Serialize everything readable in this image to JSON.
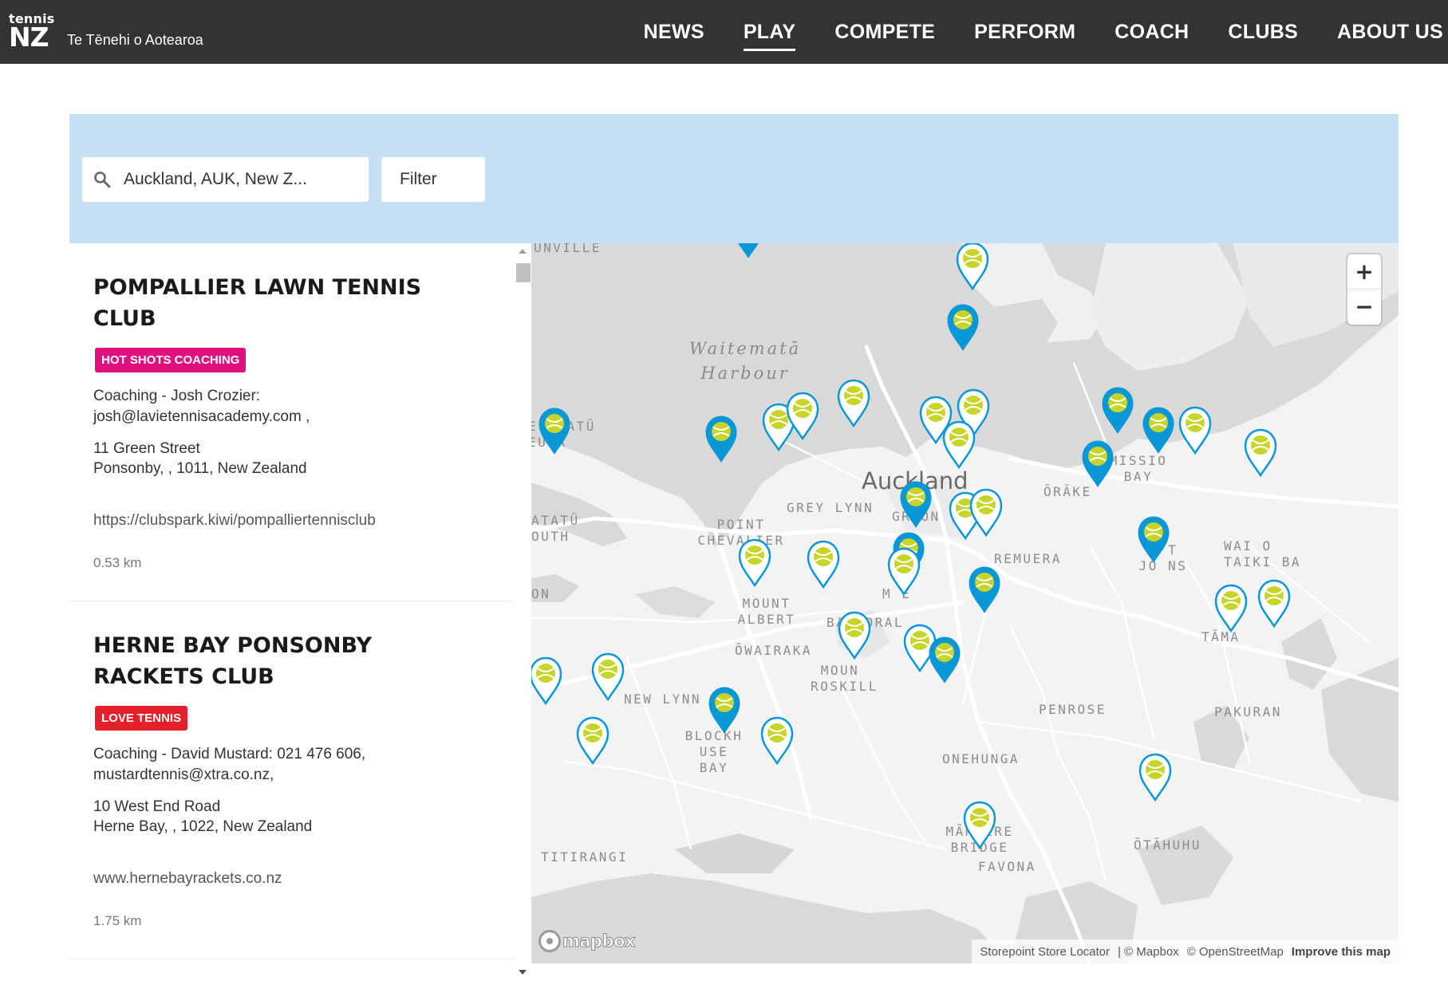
{
  "header": {
    "logo_small": "tennis",
    "logo_big": "NZ",
    "tagline": "Te Tēnehi o Aotearoa",
    "nav": [
      "NEWS",
      "PLAY",
      "COMPETE",
      "PERFORM",
      "COACH",
      "CLUBS",
      "ABOUT US"
    ],
    "active_nav": "PLAY"
  },
  "search": {
    "value": "Auckland, AUK, New Z...",
    "filter_label": "Filter"
  },
  "results": [
    {
      "name": "POMPALLIER LAWN TENNIS CLUB",
      "badge": "HOT SHOTS COACHING",
      "badge_color": "#e0117f",
      "coaching_line1": "Coaching - Josh Crozier:",
      "coaching_line2": "josh@lavietennisacademy.com ,",
      "address_line1": "11 Green Street",
      "address_line2": "Ponsonby, , 1011, New Zealand",
      "website": "https://clubspark.kiwi/pompalliertennisclub",
      "distance": "0.53 km"
    },
    {
      "name": "HERNE BAY PONSONBY RACKETS CLUB",
      "badge": "LOVE TENNIS",
      "badge_color": "#e4202a",
      "coaching_line1": "Coaching - David Mustard: 021 476 606,",
      "coaching_line2": "mustardtennis@xtra.co.nz,",
      "address_line1": "10 West End Road",
      "address_line2": "Herne Bay, , 1022, New Zealand",
      "website": "www.hernebayrackets.co.nz",
      "distance": "1.75 km"
    }
  ],
  "map": {
    "zoom_in": "+",
    "zoom_out": "−",
    "city_label": "Auckland",
    "water_label_line1": "Waitematā",
    "water_label_line2": "Harbour",
    "labels": {
      "unville": "UNVILLE",
      "te_atatu_pen_1": "E ATATŪ",
      "te_atatu_pen_2": "EULA",
      "te_atatu_south_1": "ATATŪ",
      "te_atatu_south_2": "OUTH",
      "on": "ON",
      "point_chevalier_1": "POINT",
      "point_chevalier_2": "CHEVALIER",
      "grey_lynn": "GREY LYNN",
      "grafton": "GR    ON",
      "orakei": "ŌRĀKE",
      "mission_bay_1": "MISSIO",
      "mission_bay_2": "BAY",
      "remuera": "REMUERA",
      "st_johns_1": "S    T",
      "st_johns_2": "JO NS",
      "wai_o_taiki_1": "WAI O",
      "wai_o_taiki_2": "TAIKI BA",
      "mount_albert_1": "MOUNT",
      "mount_albert_2": "ALBERT",
      "balmoral": "BALMORAL",
      "owairaka": "ŌWAIRAKA",
      "tamaki": "TĀMA",
      "mount_roskill_1": "MOUN",
      "mount_roskill_2": "ROSKILL",
      "new_lynn": "NEW LYNN",
      "penrose": "PENROSE",
      "pakuranga": "PAKURAN",
      "blockhouse_bay_1": "BLOCKH  USE",
      "blockhouse_bay_2": "BAY",
      "onehunga": "ONEHUNGA",
      "mangere_bridge_1": "MĀN  ERE",
      "mangere_bridge_2": "BRIDGE",
      "otahuhu": "ŌTĀHUHU",
      "titirangi": "TITIRANGI",
      "favona": "FAVONA",
      "mt_eden": "M     E"
    },
    "mapbox_logo": "mapbox",
    "attribution": [
      "Storepoint Store Locator",
      "| © Mapbox",
      "© OpenStreetMap"
    ],
    "improve_link": "Improve this map"
  },
  "colors": {
    "header_bg": "#333333",
    "search_band": "#c7e0f4",
    "pin_blue": "#0a97d6",
    "ball_yellow": "#c7d52b"
  },
  "icons": {
    "search": "search-icon",
    "pin": "map-pin-icon",
    "ball": "tennis-ball-icon"
  }
}
